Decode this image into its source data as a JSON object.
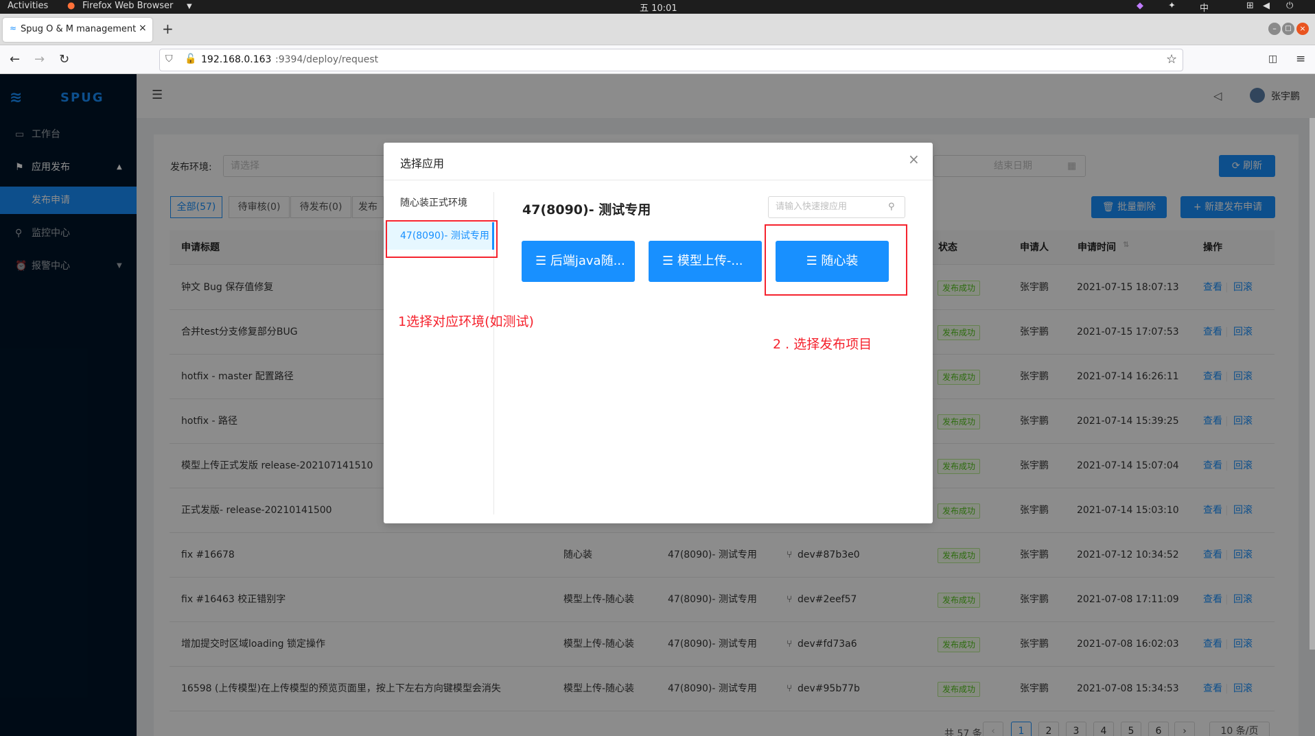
{
  "os_bar": {
    "activities": "Activities",
    "app_name": "Firefox Web Browser",
    "clock": "五 10:01",
    "input_method": "中"
  },
  "browser": {
    "tab_title": "Spug O & M management",
    "url_host": "192.168.0.163",
    "url_rest": ":9394/deploy/request"
  },
  "sidebar": {
    "logo": "SPUG",
    "items": [
      {
        "label": "工作台"
      },
      {
        "label": "应用发布"
      },
      {
        "label": "发布申请"
      },
      {
        "label": "监控中心"
      },
      {
        "label": "报警中心"
      }
    ]
  },
  "header": {
    "user": "张宇鹏"
  },
  "filters": {
    "env_label": "发布环境:",
    "env_placeholder": "请选择",
    "end_date_placeholder": "结束日期",
    "refresh": "刷新"
  },
  "status_tabs": [
    {
      "label": "全部(57)"
    },
    {
      "label": "待审核(0)"
    },
    {
      "label": "待发布(0)"
    },
    {
      "label": "发布"
    }
  ],
  "actions": {
    "batch_delete": "批量删除",
    "new_request": "新建发布申请"
  },
  "table": {
    "headers": {
      "title": "申请标题",
      "status": "状态",
      "applicant": "申请人",
      "time": "申请时间",
      "ops": "操作"
    },
    "rows": [
      {
        "title": "钟文 Bug 保存值修复",
        "app": "",
        "env": "",
        "version": "",
        "status": "发布成功",
        "applicant": "张宇鹏",
        "time": "2021-07-15 18:07:13"
      },
      {
        "title": "合并test分支修复部分BUG",
        "app": "",
        "env": "",
        "version": "",
        "status": "发布成功",
        "applicant": "张宇鹏",
        "time": "2021-07-15 17:07:53"
      },
      {
        "title": "hotfix - master 配置路径",
        "app": "",
        "env": "",
        "version": "",
        "status": "发布成功",
        "applicant": "张宇鹏",
        "time": "2021-07-14 16:26:11"
      },
      {
        "title": "hotfix - 路径",
        "app": "",
        "env": "",
        "version": "",
        "status": "发布成功",
        "applicant": "张宇鹏",
        "time": "2021-07-14 15:39:25"
      },
      {
        "title": "模型上传正式发版 release-202107141510",
        "app": "",
        "env": "",
        "version": "",
        "status": "发布成功",
        "applicant": "张宇鹏",
        "time": "2021-07-14 15:07:04"
      },
      {
        "title": "正式发版- release-20210141500",
        "app": "",
        "env": "",
        "version": "",
        "status": "发布成功",
        "applicant": "张宇鹏",
        "time": "2021-07-14 15:03:10"
      },
      {
        "title": "fix #16678",
        "app": "随心装",
        "env": "47(8090)- 测试专用",
        "version": "dev#87b3e0",
        "status": "发布成功",
        "applicant": "张宇鹏",
        "time": "2021-07-12 10:34:52"
      },
      {
        "title": "fix #16463 校正错别字",
        "app": "模型上传-随心装",
        "env": "47(8090)- 测试专用",
        "version": "dev#2eef57",
        "status": "发布成功",
        "applicant": "张宇鹏",
        "time": "2021-07-08 17:11:09"
      },
      {
        "title": "增加提交时区域loading 锁定操作",
        "app": "模型上传-随心装",
        "env": "47(8090)- 测试专用",
        "version": "dev#fd73a6",
        "status": "发布成功",
        "applicant": "张宇鹏",
        "time": "2021-07-08 16:02:03"
      },
      {
        "title": "16598 (上传模型)在上传模型的预览页面里，按上下左右方向键模型会消失",
        "app": "模型上传-随心装",
        "env": "47(8090)- 测试专用",
        "version": "dev#95b77b",
        "status": "发布成功",
        "applicant": "张宇鹏",
        "time": "2021-07-08 15:34:53"
      }
    ],
    "op_view": "查看",
    "op_rollback": "回滚"
  },
  "pagination": {
    "total": "共 57 条",
    "pages": [
      "1",
      "2",
      "3",
      "4",
      "5",
      "6"
    ],
    "size": "10 条/页"
  },
  "modal": {
    "title": "选择应用",
    "envs": [
      {
        "label": "随心装正式环境"
      },
      {
        "label": "47(8090)- 测试专用"
      }
    ],
    "selected_env_title": "47(8090)- 测试专用",
    "search_placeholder": "请输入快速搜应用",
    "apps": [
      {
        "label": "后端java随..."
      },
      {
        "label": "模型上传-..."
      },
      {
        "label": "随心装"
      }
    ]
  },
  "annotations": {
    "step1": "1选择对应环境(如测试)",
    "step2": "2 . 选择发布项目",
    "color": "#f5222d"
  }
}
